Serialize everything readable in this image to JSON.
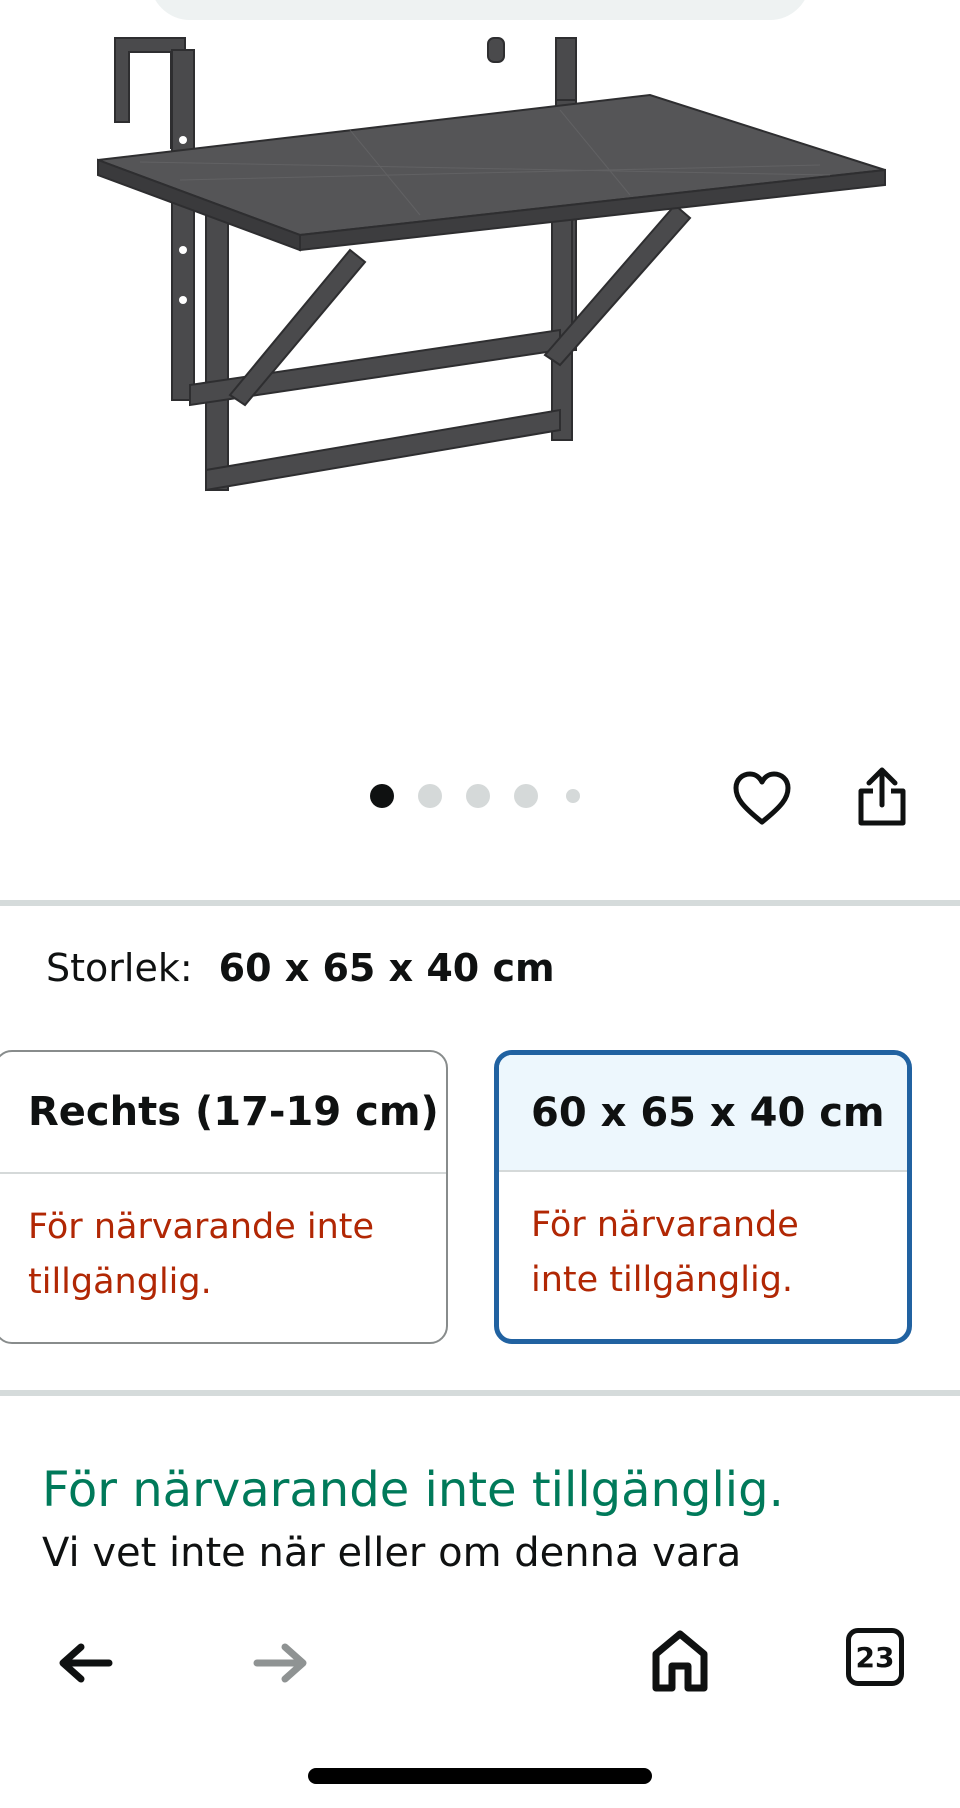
{
  "carousel": {
    "total_images": 5,
    "current_index": 1
  },
  "actions": {
    "favorite_icon": "heart-outline-icon",
    "share_icon": "share-icon"
  },
  "size_selector": {
    "label": "Storlek:",
    "selected_value": "60 x 65 x 40 cm",
    "options": [
      {
        "name": "Rechts (17-19 cm)",
        "status": "För närvarande inte tillgänglig.",
        "selected": false
      },
      {
        "name": "60 x 65 x 40 cm",
        "status": "För närvarande inte tillgänglig.",
        "selected": true
      }
    ]
  },
  "availability": {
    "title": "För närvarande inte tillgänglig.",
    "description": "Vi vet inte när eller om denna vara"
  },
  "bottom_nav": {
    "back_icon": "arrow-left-icon",
    "forward_icon": "arrow-right-icon",
    "home_icon": "home-icon",
    "tabs_count": "23"
  },
  "colors": {
    "unavailable_red": "#b12704",
    "availability_green": "#007a5a",
    "selected_border": "#2162a1",
    "selected_fill": "#edf7fd"
  }
}
